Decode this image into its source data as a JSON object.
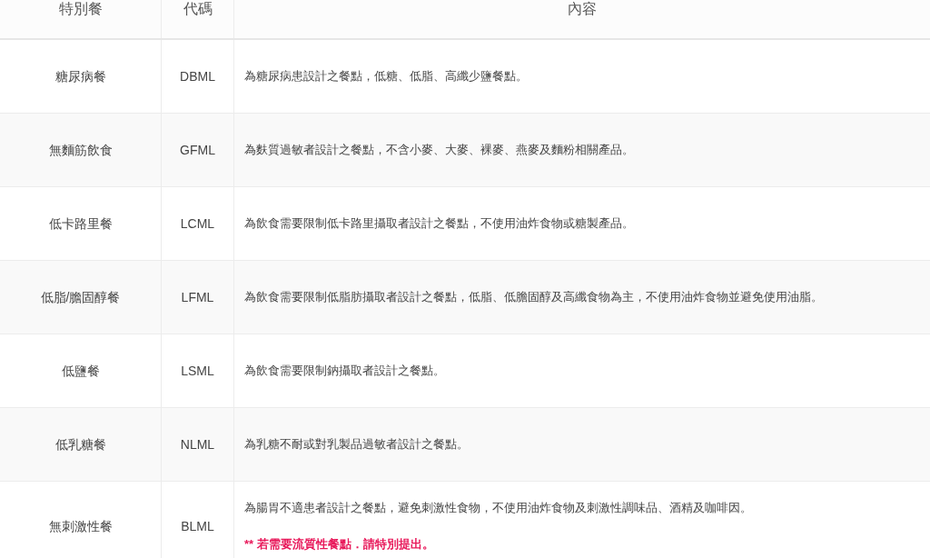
{
  "table": {
    "columns": [
      "特別餐",
      "代碼",
      "內容"
    ],
    "rows": [
      {
        "meal": "糖尿病餐",
        "code": "DBML",
        "description": "為糖尿病患設計之餐點，低糖、低脂、高纖少鹽餐點。"
      },
      {
        "meal": "無麵筋飲食",
        "code": "GFML",
        "description": "為麩質過敏者設計之餐點，不含小麥、大麥、裸麥、燕麥及麵粉相關產品。"
      },
      {
        "meal": "低卡路里餐",
        "code": "LCML",
        "description": "為飲食需要限制低卡路里攝取者設計之餐點，不使用油炸食物或糖製產品。"
      },
      {
        "meal": "低脂/膽固醇餐",
        "code": "LFML",
        "description": "為飲食需要限制低脂肪攝取者設計之餐點，低脂、低膽固醇及高纖食物為主，不使用油炸食物並避免使用油脂。"
      },
      {
        "meal": "低鹽餐",
        "code": "LSML",
        "description": "為飲食需要限制鈉攝取者設計之餐點。"
      },
      {
        "meal": "低乳糖餐",
        "code": "NLML",
        "description": "為乳糖不耐或對乳製品過敏者設計之餐點。"
      },
      {
        "meal": "無刺激性餐",
        "code": "BLML",
        "description": "為腸胃不適患者設計之餐點，避免刺激性食物，不使用油炸食物及刺激性調味品、酒精及咖啡因。",
        "note": "** 若需要流質性餐點．請特別提出。"
      }
    ]
  }
}
